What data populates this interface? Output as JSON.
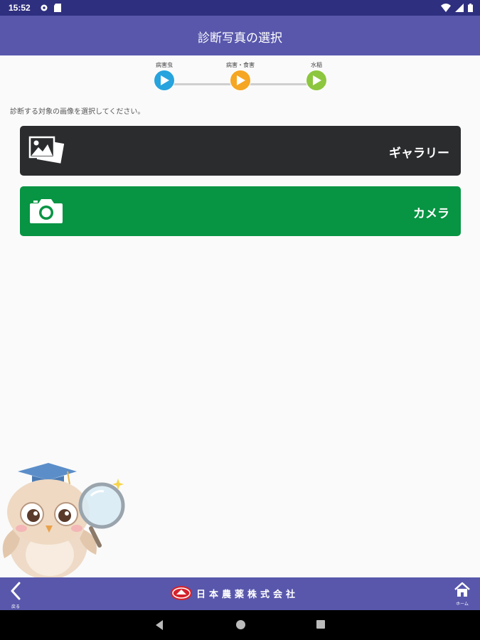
{
  "status_bar": {
    "time": "15:52",
    "icons": [
      "settings-icon",
      "sd-card-icon",
      "wifi-icon",
      "signal-icon",
      "battery-icon"
    ]
  },
  "header": {
    "title": "診断写真の選択"
  },
  "steps": [
    {
      "label": "病害虫",
      "color": "#27a3dd",
      "icon": "play-icon"
    },
    {
      "label": "病害・食害",
      "color": "#f5a623",
      "icon": "play-icon"
    },
    {
      "label": "水稲",
      "color": "#8dc63f",
      "icon": "play-icon"
    }
  ],
  "instruction": "診断する対象の画像を選択してください。",
  "buttons": {
    "gallery": {
      "label": "ギャラリー",
      "icon": "gallery-icon",
      "color": "#2b2c2e"
    },
    "camera": {
      "label": "カメラ",
      "icon": "camera-icon",
      "color": "#079443"
    }
  },
  "mascot": "owl-mascot-illustration",
  "footer": {
    "back_label": "戻る",
    "home_label": "ホーム",
    "company_name": "日本農薬株式会社"
  },
  "colors": {
    "primary": "#5857ac",
    "status_bar": "#2f2f7f"
  }
}
